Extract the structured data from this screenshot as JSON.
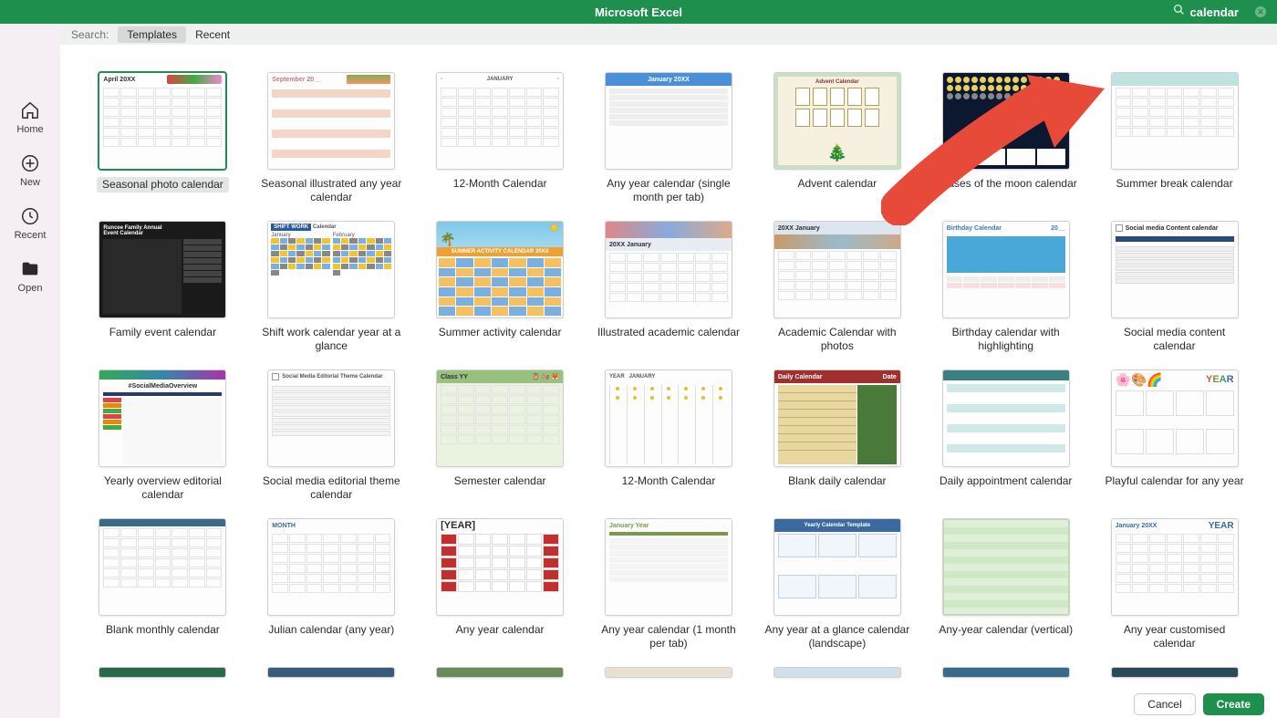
{
  "titlebar": {
    "app": "Microsoft Excel",
    "search_query": "calendar"
  },
  "sidebar": {
    "items": [
      {
        "label": "Home"
      },
      {
        "label": "New"
      },
      {
        "label": "Recent"
      },
      {
        "label": "Open"
      }
    ]
  },
  "filterbar": {
    "label": "Search:",
    "templates": "Templates",
    "recent": "Recent"
  },
  "colors": {
    "accent": "#1f8f4e",
    "arrow": "#e84a3a"
  },
  "footer": {
    "cancel": "Cancel",
    "create": "Create"
  },
  "templates": [
    {
      "name": "Seasonal photo calendar",
      "selected": true
    },
    {
      "name": "Seasonal illustrated any year calendar"
    },
    {
      "name": "12-Month Calendar"
    },
    {
      "name": "Any year calendar (single month per tab)"
    },
    {
      "name": "Advent calendar"
    },
    {
      "name": "Phases of the moon calendar"
    },
    {
      "name": "Summer break calendar"
    },
    {
      "name": "Family event calendar"
    },
    {
      "name": "Shift work calendar year at a glance"
    },
    {
      "name": "Summer activity calendar"
    },
    {
      "name": "Illustrated academic calendar"
    },
    {
      "name": "Academic Calendar with photos"
    },
    {
      "name": "Birthday calendar with highlighting"
    },
    {
      "name": "Social media content calendar"
    },
    {
      "name": "Yearly overview editorial calendar"
    },
    {
      "name": "Social media editorial theme calendar"
    },
    {
      "name": "Semester calendar"
    },
    {
      "name": "12-Month Calendar"
    },
    {
      "name": "Blank daily calendar"
    },
    {
      "name": "Daily appointment calendar"
    },
    {
      "name": "Playful calendar for any year"
    },
    {
      "name": "Blank monthly calendar"
    },
    {
      "name": "Julian calendar (any year)"
    },
    {
      "name": "Any year calendar"
    },
    {
      "name": "Any year calendar (1 month per tab)"
    },
    {
      "name": "Any year at a glance calendar (landscape)"
    },
    {
      "name": "Any-year calendar (vertical)"
    },
    {
      "name": "Any year customised calendar"
    }
  ],
  "thumb_text": {
    "t0": "April 20XX",
    "t1": "September 20__",
    "t2": "JANUARY",
    "t3": "January 20XX",
    "t5_moon": "",
    "t8": "SHIFT WORK Calendar",
    "t9": "SUMMER ACTIVITY CALENDAR 20XX",
    "t10": "20XX January",
    "t11": "20XX January",
    "t12": "Birthday Calendar    20__",
    "t13": "Social media Content calendar",
    "t14": "#SocialMediaOverview",
    "t15": "Social Media Editorial Theme Calendar",
    "t16": "Class YY",
    "t17": "JANUARY",
    "t18": "Daily Calendar",
    "t20": "YEAR",
    "t22": "MONTH",
    "t23": "[YEAR]",
    "t24": "January Year",
    "t25": "Yearly Calendar Template",
    "t27": "January 20XX"
  }
}
